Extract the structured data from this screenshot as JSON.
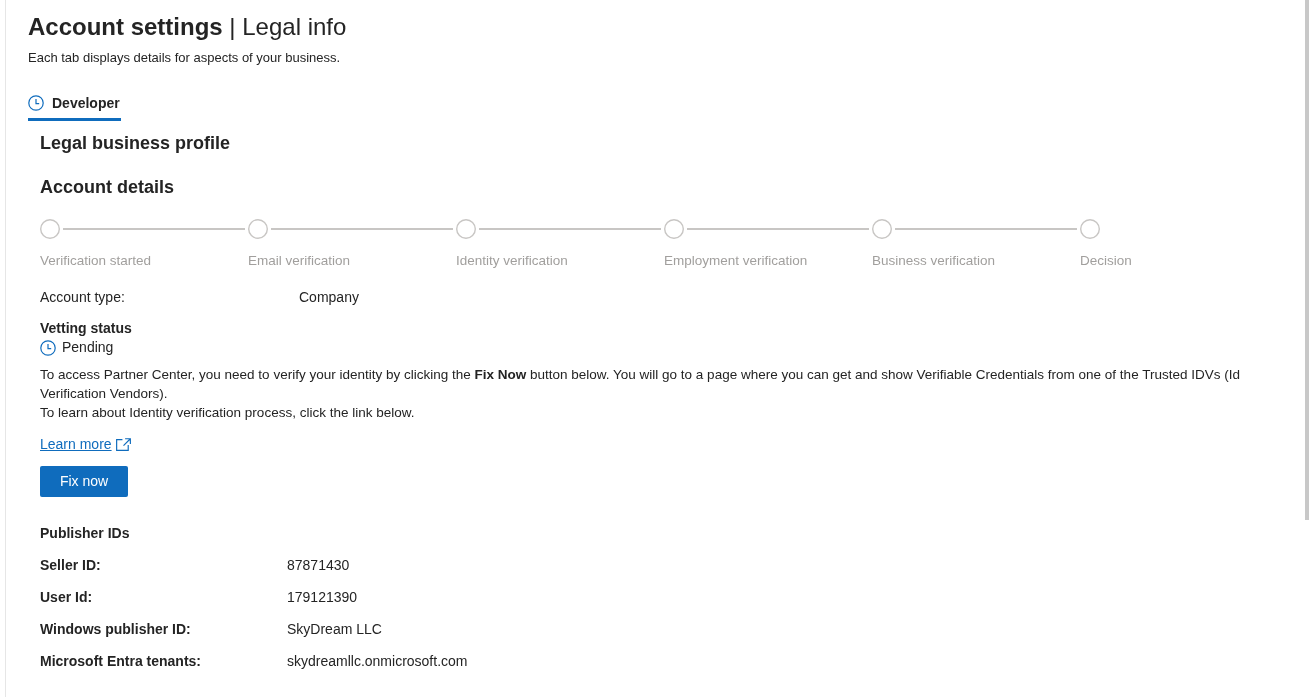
{
  "header": {
    "title": "**Account settings** | Legal info",
    "subtitle": "Each tab displays details for aspects of your business."
  },
  "tabs": [
    {
      "label": "Developer",
      "selected": true
    }
  ],
  "profile_heading": "Legal business profile",
  "account_details": {
    "heading": "Account details",
    "steps": [
      {
        "label": "Verification started"
      },
      {
        "label": "Email verification"
      },
      {
        "label": "Identity verification"
      },
      {
        "label": "Employment verification"
      },
      {
        "label": "Business verification"
      },
      {
        "label": "Decision"
      }
    ],
    "account_type": {
      "label": "Account type:",
      "value": "Company"
    }
  },
  "vetting": {
    "heading": "Vetting status",
    "status": "Pending",
    "paragraphs": [
      "To access Partner Center, you need to verify your identity by clicking the **Fix Now** button below. You will go to a page where you can get and show Verifiable Credentials from one of the Trusted IDVs (Id Verification Vendors).",
      "To learn about Identity verification process, click the link below."
    ],
    "link": "Learn more",
    "button": "Fix now"
  },
  "publisher_ids": {
    "heading": "Publisher IDs",
    "rows": [
      {
        "label": "Seller ID:",
        "value": "87871430"
      },
      {
        "label": "User Id:",
        "value": "179121390"
      },
      {
        "label": "Windows publisher ID:",
        "value": "SkyDream LLC"
      },
      {
        "label": "Microsoft Entra tenants:",
        "value": "skydreamllc.onmicrosoft.com"
      }
    ]
  }
}
